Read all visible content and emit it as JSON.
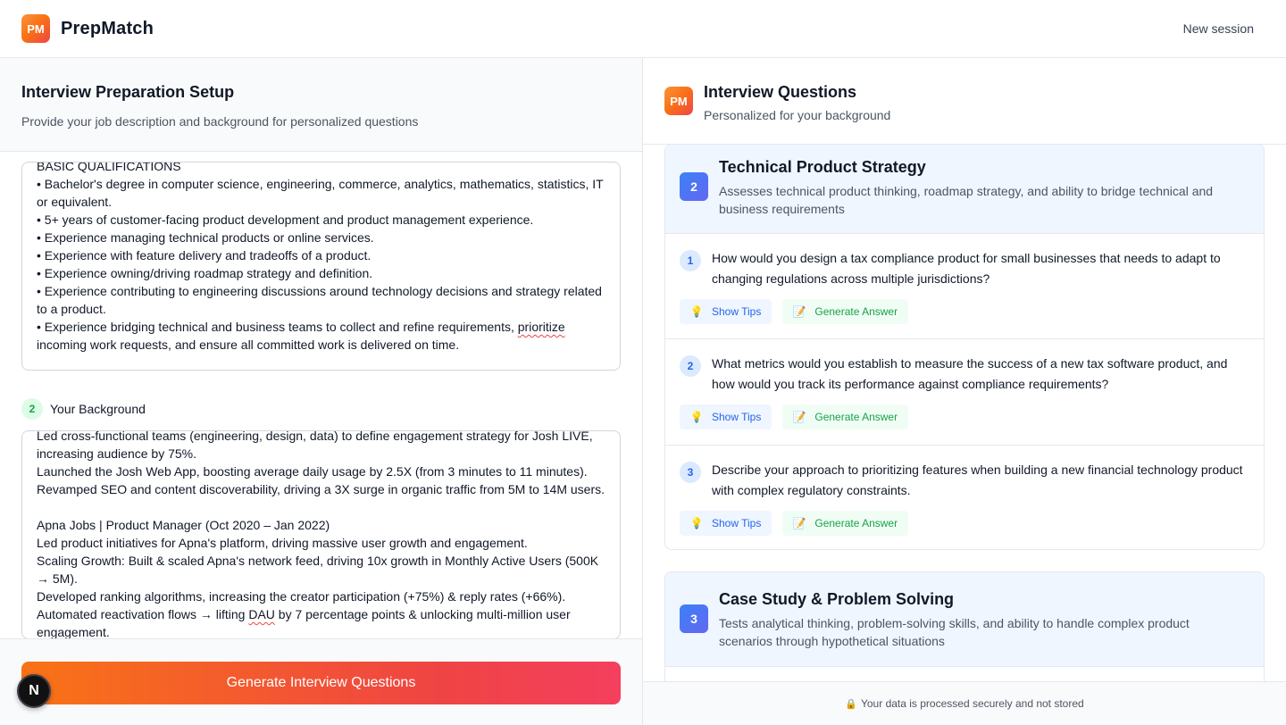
{
  "app": {
    "logo_text": "PM",
    "name": "PrepMatch",
    "new_session_label": "New session"
  },
  "setup": {
    "title": "Interview Preparation Setup",
    "subtitle": "Provide your job description and background for personalized questions",
    "job_description_lines": [
      "BASIC QUALIFICATIONS",
      "• Bachelor's degree in computer science, engineering, commerce, analytics, mathematics, statistics, IT or equivalent.",
      "• 5+ years of customer-facing product development and product management experience.",
      "• Experience managing technical products or online services.",
      "• Experience with feature delivery and tradeoffs of a product.",
      "• Experience owning/driving roadmap strategy and definition.",
      "• Experience contributing to engineering discussions around technology decisions and strategy related to a product."
    ],
    "job_description_last_pre": "• Experience bridging technical and business teams to collect and refine requirements, ",
    "job_description_last_spell": "prioritize",
    "job_description_last_post": " incoming work requests, and ensure all committed work is delivered on time.",
    "background_step_number": "2",
    "background_label": "Your Background",
    "background_lines": [
      "Led cross-functional teams (engineering, design, data) to define engagement strategy for Josh LIVE, increasing audience by 75%.",
      "Launched the Josh Web App, boosting average daily usage by 2.5X (from 3 minutes to 11 minutes).",
      "Revamped SEO and content discoverability, driving a 3X surge in organic traffic from 5M to 14M users.",
      "",
      "Apna Jobs | Product Manager (Oct 2020 – Jan 2022)",
      "Led product initiatives for Apna's platform, driving massive user growth and engagement.",
      "Scaling Growth: Built & scaled Apna's network feed, driving 10x growth in Monthly Active Users (500K → 5M).",
      "Developed ranking algorithms, increasing the creator participation (+75%) & reply rates (+66%)."
    ],
    "background_last_pre": "Automated reactivation flows → lifting ",
    "background_last_spell": "DAU",
    "background_last_post": " by 7 percentage points & unlocking multi-million user engagement.",
    "generate_button_label": "Generate Interview Questions",
    "floating_badge": "N"
  },
  "questions_panel": {
    "logo_text": "PM",
    "title": "Interview Questions",
    "subtitle": "Personalized for your background",
    "categories": [
      {
        "number": "2",
        "title": "Technical Product Strategy",
        "description": "Assesses technical product thinking, roadmap strategy, and ability to bridge technical and business requirements",
        "questions": [
          {
            "number": "1",
            "text": "How would you design a tax compliance product for small businesses that needs to adapt to changing regulations across multiple jurisdictions?"
          },
          {
            "number": "2",
            "text": "What metrics would you establish to measure the success of a new tax software product, and how would you track its performance against compliance requirements?"
          },
          {
            "number": "3",
            "text": "Describe your approach to prioritizing features when building a new financial technology product with complex regulatory constraints."
          }
        ]
      },
      {
        "number": "3",
        "title": "Case Study & Problem Solving",
        "description": "Tests analytical thinking, problem-solving skills, and ability to handle complex product scenarios through hypothetical situations",
        "questions": []
      }
    ],
    "show_tips_label": "Show Tips",
    "generate_answer_label": "Generate Answer",
    "tips_icon": "lightbulb-icon",
    "answer_icon": "memo-icon",
    "footer_note": "Your data is processed securely and not stored"
  },
  "colors": {
    "brand_gradient_start": "#f97316",
    "brand_gradient_end": "#ef4444",
    "category_badge": "#3b82f6",
    "tips_text": "#2563eb",
    "answer_text": "#16a34a"
  }
}
